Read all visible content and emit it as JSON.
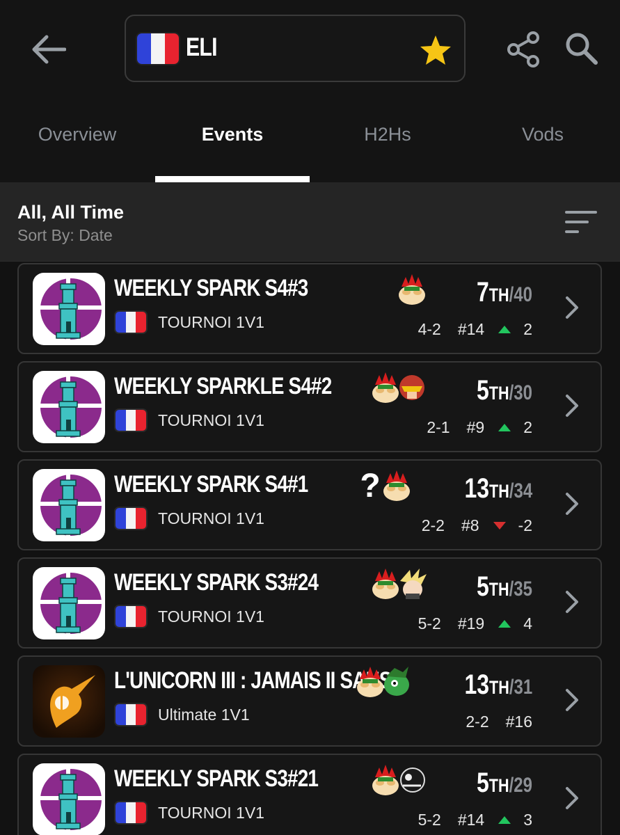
{
  "header": {
    "player_name": "ELI",
    "flag_country": "France",
    "star_color": "#f6c515"
  },
  "tabs": [
    {
      "label": "Overview",
      "active": false
    },
    {
      "label": "Events",
      "active": true
    },
    {
      "label": "H2Hs",
      "active": false
    },
    {
      "label": "Vods",
      "active": false
    }
  ],
  "filter": {
    "title": "All, All Time",
    "sort_label": "Sort By: Date"
  },
  "events": [
    {
      "title": "WEEKLY SPARK S4#3",
      "subtitle": "TOURNOI 1V1",
      "icon": "smash-tower-icon",
      "characters": [
        "bowser-icon"
      ],
      "placing": "7",
      "suffix": "TH",
      "total": "/40",
      "record": "4-2",
      "seed": "#14",
      "trend": "up",
      "delta": "2"
    },
    {
      "title": "WEEKLY SPARKLE S4#2",
      "subtitle": "TOURNOI 1V1",
      "icon": "smash-tower-icon",
      "characters": [
        "bowser-icon",
        "captain-falcon-icon"
      ],
      "placing": "5",
      "suffix": "TH",
      "total": "/30",
      "record": "2-1",
      "seed": "#9",
      "trend": "up",
      "delta": "2"
    },
    {
      "title": "WEEKLY SPARK S4#1",
      "subtitle": "TOURNOI 1V1",
      "icon": "smash-tower-icon",
      "characters": [
        "random-character-icon",
        "bowser-icon"
      ],
      "placing": "13",
      "suffix": "TH",
      "total": "/34",
      "record": "2-2",
      "seed": "#8",
      "trend": "down",
      "delta": "-2"
    },
    {
      "title": "WEEKLY SPARK S3#24",
      "subtitle": "TOURNOI 1V1",
      "icon": "smash-tower-icon",
      "characters": [
        "bowser-icon",
        "cloud-icon"
      ],
      "placing": "5",
      "suffix": "TH",
      "total": "/35",
      "record": "5-2",
      "seed": "#19",
      "trend": "up",
      "delta": "4"
    },
    {
      "title": "L'UNICORN III : JAMAIS II SANS...",
      "subtitle": "Ultimate 1V1",
      "icon": "unicorn-icon",
      "characters": [
        "bowser-icon",
        "bowser-jr-icon"
      ],
      "placing": "13",
      "suffix": "TH",
      "total": "/31",
      "record": "2-2",
      "seed": "#16",
      "trend": "none",
      "delta": ""
    },
    {
      "title": "WEEKLY SPARK S3#21",
      "subtitle": "TOURNOI 1V1",
      "icon": "smash-tower-icon",
      "characters": [
        "bowser-icon",
        "game-and-watch-icon"
      ],
      "placing": "5",
      "suffix": "TH",
      "total": "/29",
      "record": "5-2",
      "seed": "#14",
      "trend": "up",
      "delta": "3"
    }
  ]
}
